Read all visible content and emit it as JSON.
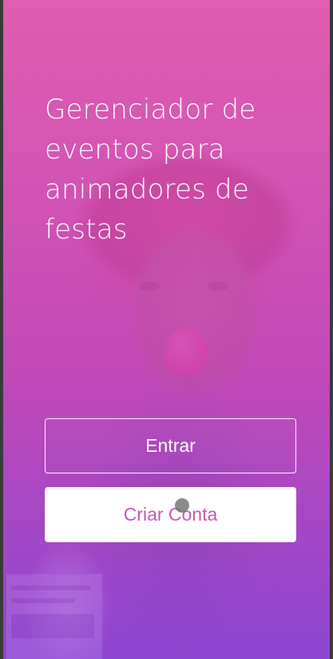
{
  "welcome": {
    "headline": "Gerenciador de eventos para animadores de festas",
    "login_label": "Entrar",
    "signup_label": "Criar Conta"
  },
  "background": {
    "image": "clown-portrait-photo",
    "overlay_colors": [
      "#e85ab4",
      "#c846be",
      "#8c46dc"
    ]
  },
  "colors": {
    "signup_text": "#c15bb8",
    "button_outline": "#ffffff"
  }
}
